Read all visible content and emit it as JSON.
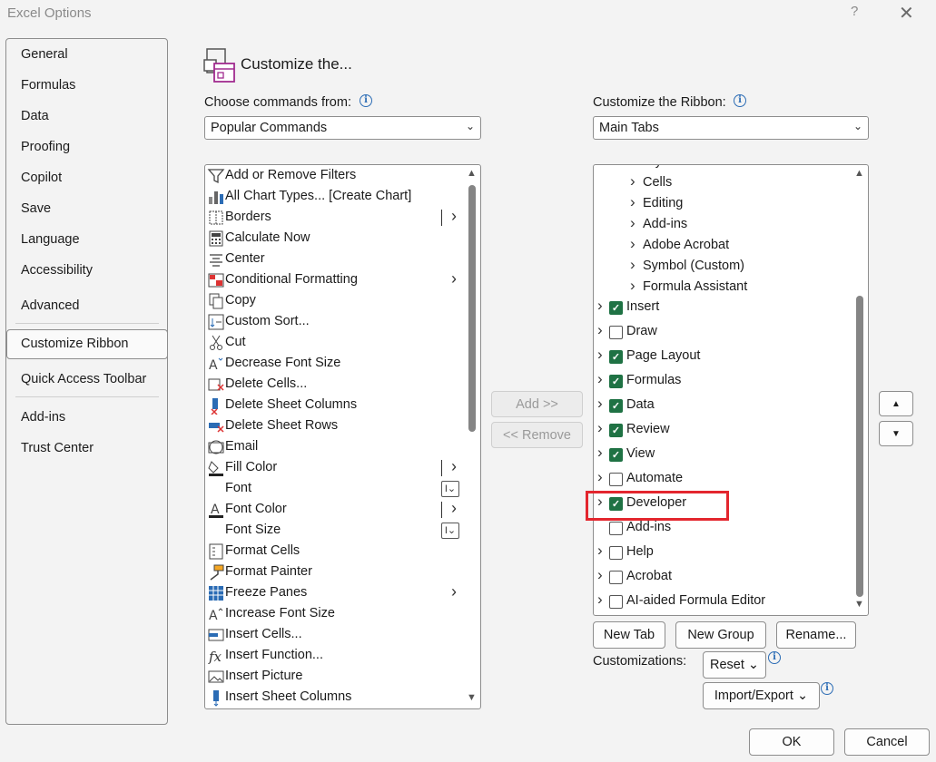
{
  "window": {
    "title": "Excel Options",
    "help": "?",
    "close": "✕"
  },
  "nav": {
    "items": [
      "General",
      "Formulas",
      "Data",
      "Proofing",
      "Copilot",
      "Save",
      "Language",
      "Accessibility",
      "Advanced",
      "Customize Ribbon",
      "Quick Access Toolbar",
      "Add-ins",
      "Trust Center"
    ],
    "selected": "Customize Ribbon"
  },
  "header": {
    "title": "Customize the..."
  },
  "left": {
    "label": "Choose commands from:",
    "combo_value": "Popular Commands",
    "commands": [
      {
        "label": "Add or Remove Filters",
        "icon": "filter-icon"
      },
      {
        "label": "All Chart Types... [Create Chart]",
        "icon": "chart-icon"
      },
      {
        "label": "Borders",
        "icon": "borders-icon",
        "sub": "split-arrow"
      },
      {
        "label": "Calculate Now",
        "icon": "calculator-icon"
      },
      {
        "label": "Center",
        "icon": "align-center-icon"
      },
      {
        "label": "Conditional Formatting",
        "icon": "conditional-formatting-icon",
        "sub": "arrow"
      },
      {
        "label": "Copy",
        "icon": "copy-icon"
      },
      {
        "label": "Custom Sort...",
        "icon": "sort-icon"
      },
      {
        "label": "Cut",
        "icon": "scissors-icon"
      },
      {
        "label": "Decrease Font Size",
        "icon": "decrease-font-icon"
      },
      {
        "label": "Delete Cells...",
        "icon": "delete-cells-icon"
      },
      {
        "label": "Delete Sheet Columns",
        "icon": "delete-columns-icon"
      },
      {
        "label": "Delete Sheet Rows",
        "icon": "delete-rows-icon"
      },
      {
        "label": "Email",
        "icon": "email-icon"
      },
      {
        "label": "Fill Color",
        "icon": "fill-color-icon",
        "sub": "split-arrow"
      },
      {
        "label": "Font",
        "icon": "",
        "sub": "textbox"
      },
      {
        "label": "Font Color",
        "icon": "font-color-icon",
        "sub": "split-arrow"
      },
      {
        "label": "Font Size",
        "icon": "",
        "sub": "textbox"
      },
      {
        "label": "Format Cells",
        "icon": "format-cells-icon"
      },
      {
        "label": "Format Painter",
        "icon": "format-painter-icon"
      },
      {
        "label": "Freeze Panes",
        "icon": "freeze-panes-icon",
        "sub": "arrow"
      },
      {
        "label": "Increase Font Size",
        "icon": "increase-font-icon"
      },
      {
        "label": "Insert Cells...",
        "icon": "insert-cells-icon"
      },
      {
        "label": "Insert Function...",
        "icon": "function-icon"
      },
      {
        "label": "Insert Picture",
        "icon": "picture-icon"
      },
      {
        "label": "Insert Sheet Columns",
        "icon": "insert-columns-icon"
      }
    ]
  },
  "middle": {
    "add": "Add >>",
    "remove": "<< Remove"
  },
  "right": {
    "label": "Customize the Ribbon:",
    "combo_value": "Main Tabs",
    "groups": [
      "Styles",
      "Cells",
      "Editing",
      "Add-ins",
      "Adobe Acrobat",
      "Symbol (Custom)",
      "Formula Assistant"
    ],
    "tabs": [
      {
        "label": "Insert",
        "checked": true,
        "expandable": true
      },
      {
        "label": "Draw",
        "checked": false,
        "expandable": true
      },
      {
        "label": "Page Layout",
        "checked": true,
        "expandable": true
      },
      {
        "label": "Formulas",
        "checked": true,
        "expandable": true
      },
      {
        "label": "Data",
        "checked": true,
        "expandable": true
      },
      {
        "label": "Review",
        "checked": true,
        "expandable": true
      },
      {
        "label": "View",
        "checked": true,
        "expandable": true
      },
      {
        "label": "Automate",
        "checked": false,
        "expandable": true
      },
      {
        "label": "Developer",
        "checked": true,
        "expandable": true
      },
      {
        "label": "Add-ins",
        "checked": false,
        "expandable": false
      },
      {
        "label": "Help",
        "checked": false,
        "expandable": true
      },
      {
        "label": "Acrobat",
        "checked": false,
        "expandable": true
      },
      {
        "label": "AI-aided Formula Editor",
        "checked": false,
        "expandable": true
      }
    ],
    "new_tab": "New Tab",
    "new_group": "New Group",
    "rename": "Rename...",
    "customizations_label": "Customizations:",
    "reset": "Reset ⌄",
    "import_export": "Import/Export ⌄",
    "move_up": "▲",
    "move_down": "▼"
  },
  "footer": {
    "ok": "OK",
    "cancel": "Cancel"
  },
  "colors": {
    "check_green": "#1f7244",
    "highlight_red": "#e3262e",
    "info_blue": "#2b6cb5"
  }
}
